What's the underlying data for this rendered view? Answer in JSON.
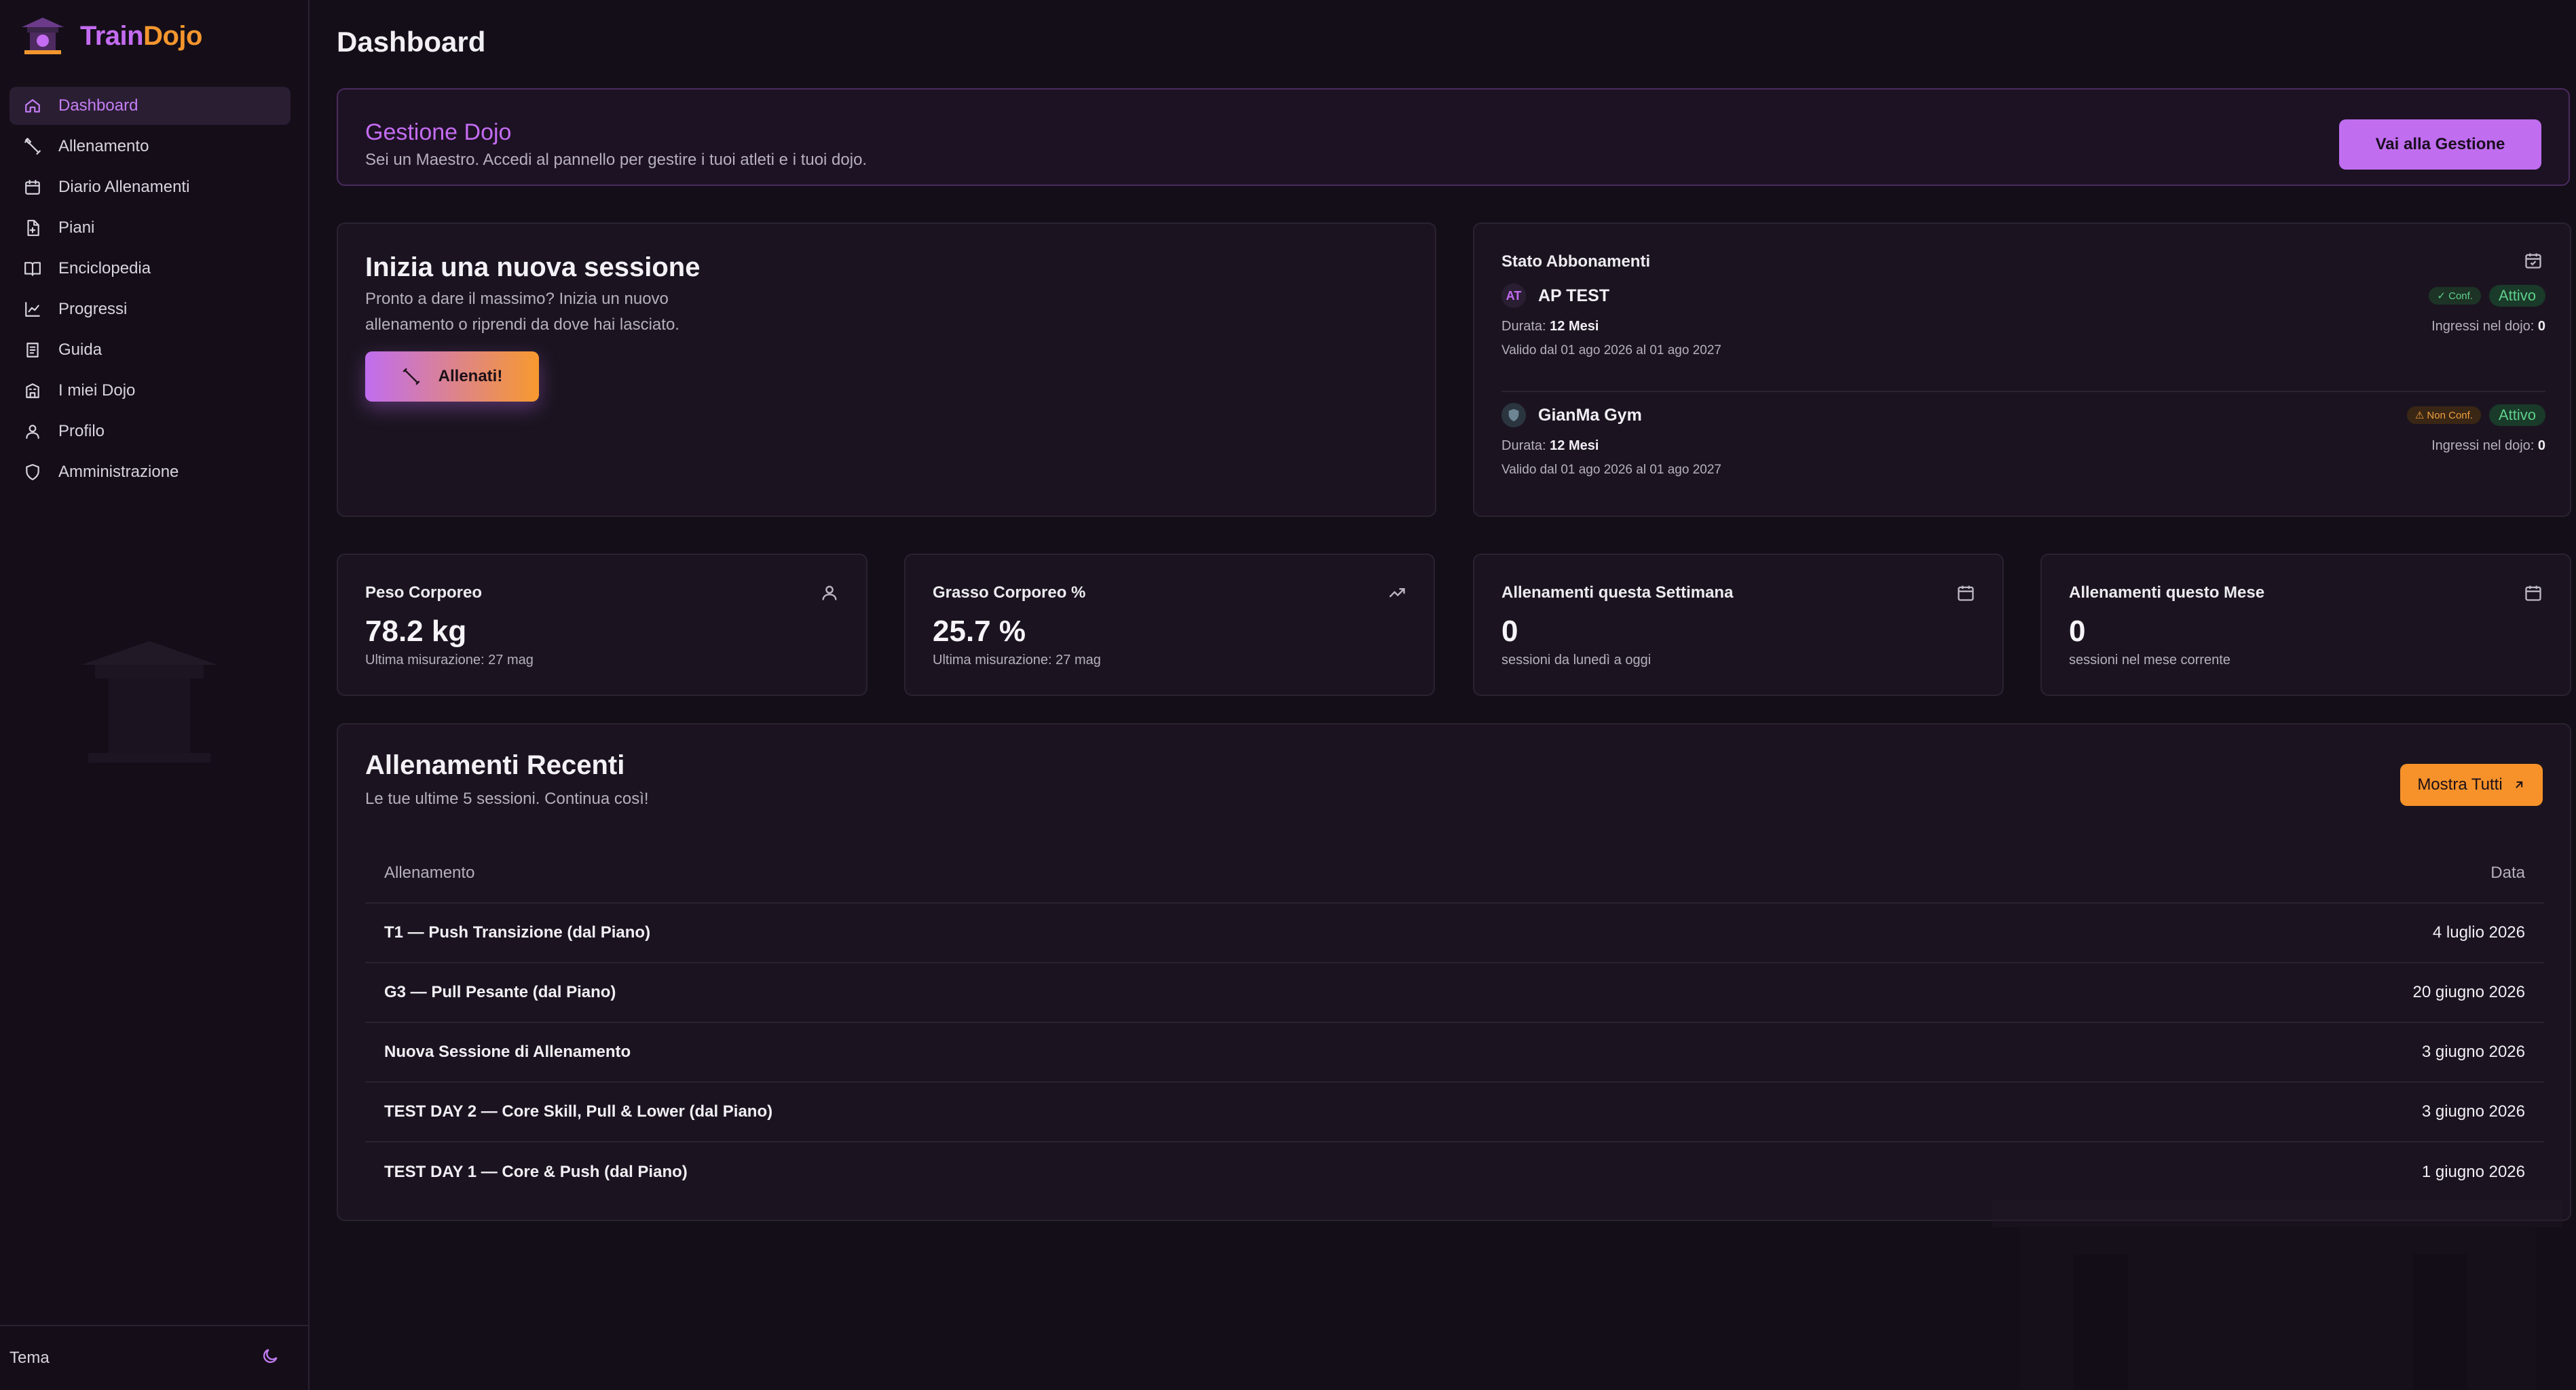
{
  "app": {
    "brand_part1": "Train",
    "brand_part2": "Dojo"
  },
  "sidebar": {
    "items": [
      {
        "label": "Dashboard",
        "icon": "home-icon",
        "active": true
      },
      {
        "label": "Allenamento",
        "icon": "dumbbell-icon"
      },
      {
        "label": "Diario Allenamenti",
        "icon": "calendar-icon"
      },
      {
        "label": "Piani",
        "icon": "file-plan-icon"
      },
      {
        "label": "Enciclopedia",
        "icon": "book-open-icon"
      },
      {
        "label": "Progressi",
        "icon": "chart-line-icon"
      },
      {
        "label": "Guida",
        "icon": "book-guide-icon"
      },
      {
        "label": "I miei Dojo",
        "icon": "building-icon"
      },
      {
        "label": "Profilo",
        "icon": "user-icon"
      },
      {
        "label": "Amministrazione",
        "icon": "shield-icon"
      }
    ],
    "footer": {
      "label": "Tema",
      "icon": "moon-icon"
    }
  },
  "page": {
    "title": "Dashboard"
  },
  "banner": {
    "title": "Gestione Dojo",
    "subtitle": "Sei un Maestro. Accedi al pannello per gestire i tuoi atleti e i tuoi dojo.",
    "button": "Vai alla Gestione"
  },
  "session": {
    "title": "Inizia una nuova sessione",
    "subtitle": "Pronto a dare il massimo? Inizia un nuovo allenamento o riprendi da dove hai lasciato.",
    "button": "Allenati!"
  },
  "subscriptions": {
    "title": "Stato Abbonamenti",
    "items": [
      {
        "avatar": "AT",
        "name": "AP TEST",
        "conf_badge": "✓ Conf.",
        "status": "Attivo",
        "durata_label": "Durata:",
        "durata": "12 Mesi",
        "validity": "Valido dal 01 ago 2026 al 01 ago 2027",
        "ingressi_label": "Ingressi nel dojo:",
        "ingressi": "0"
      },
      {
        "avatar": "",
        "name": "GianMa Gym",
        "conf_badge": "⚠ Non Conf.",
        "status": "Attivo",
        "durata_label": "Durata:",
        "durata": "12 Mesi",
        "validity": "Valido dal 01 ago 2026 al 01 ago 2027",
        "ingressi_label": "Ingressi nel dojo:",
        "ingressi": "0"
      }
    ]
  },
  "stats": [
    {
      "title": "Peso Corporeo",
      "value": "78.2 kg",
      "note": "Ultima misurazione: 27 mag",
      "icon": "user-icon"
    },
    {
      "title": "Grasso Corporeo %",
      "value": "25.7 %",
      "note": "Ultima misurazione: 27 mag",
      "icon": "trending-up-icon"
    },
    {
      "title": "Allenamenti questa Settimana",
      "value": "0",
      "note": "sessioni da lunedì a oggi",
      "icon": "calendar-icon"
    },
    {
      "title": "Allenamenti questo Mese",
      "value": "0",
      "note": "sessioni nel mese corrente",
      "icon": "calendar-icon"
    }
  ],
  "recent": {
    "title": "Allenamenti Recenti",
    "subtitle": "Le tue ultime 5 sessioni. Continua così!",
    "button": "Mostra Tutti",
    "columns": [
      "Allenamento",
      "Data"
    ],
    "rows": [
      {
        "name": "T1 — Push Transizione (dal Piano)",
        "date": "4 luglio 2026"
      },
      {
        "name": "G3 — Pull Pesante (dal Piano)",
        "date": "20 giugno 2026"
      },
      {
        "name": "Nuova Sessione di Allenamento",
        "date": "3 giugno 2026"
      },
      {
        "name": "TEST DAY 2 — Core Skill, Pull & Lower (dal Piano)",
        "date": "3 giugno 2026"
      },
      {
        "name": "TEST DAY 1 — Core & Push (dal Piano)",
        "date": "1 giugno 2026"
      }
    ]
  },
  "colors": {
    "accent_purple": "#c06df0",
    "accent_orange": "#f7922a",
    "background": "#140e18",
    "status_green": "#5fd08a"
  }
}
